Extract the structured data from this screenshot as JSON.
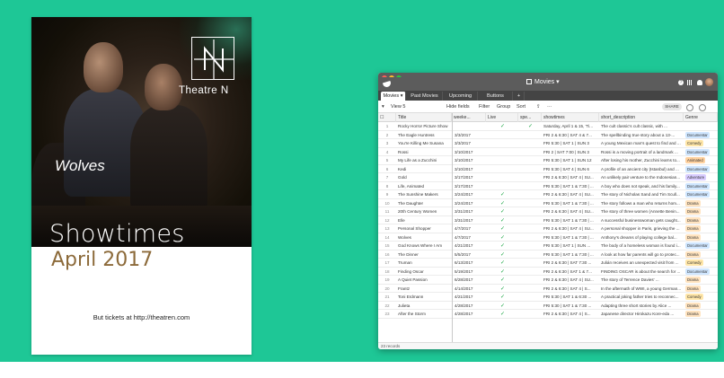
{
  "poster": {
    "brand": "Theatre N",
    "film_title": "Wolves",
    "heading": "Showtimes",
    "month": "April 2017",
    "tickets": "But tickets at http://theatren.com"
  },
  "app": {
    "base_title": "Movies ▾",
    "tabs": [
      "Movies ▾",
      "Past Movies",
      "Upcoming",
      "Buttons",
      "+"
    ],
    "view_name": "View 5",
    "toolbar": {
      "hide_fields": "Hide fields",
      "filter": "Filter",
      "group": "Group",
      "sort": "Sort",
      "share": "SHARE"
    },
    "columns": [
      "Title",
      "weeke...",
      "Live",
      "spe...",
      "showtimes",
      "short_description",
      "Genre"
    ],
    "rows": [
      {
        "n": "1",
        "title": "Rocky Horror Picture Show",
        "week": "",
        "live": true,
        "spe": true,
        "show": "Saturday, April 1 & 15, 'Ti...",
        "desc": "The cult classic's cult classic, with ...",
        "genre": ""
      },
      {
        "n": "2",
        "title": "The Eagle Huntress",
        "week": "3/3/2017",
        "live": false,
        "spe": false,
        "show": "FRI 2 & 6:30 | SAT 4 & 7...",
        "desc": "The spellbinding true story about a 13-...",
        "genre": "Documentar"
      },
      {
        "n": "3",
        "title": "You're Killing Me Susana",
        "week": "3/3/2017",
        "live": false,
        "spe": false,
        "show": "FRI 5:30 | SAT 1 | SUN 3",
        "desc": "A young Mexican man's quest to find and ...",
        "genre": "Comedy"
      },
      {
        "n": "4",
        "title": "Rossi",
        "week": "3/10/2017",
        "live": false,
        "spe": false,
        "show": "FRI 2 | SAT 7:00 | SUN 3",
        "desc": "Rossi is a moving portrait of a landmark ...",
        "genre": "Documentar"
      },
      {
        "n": "5",
        "title": "My Life as a Zucchini",
        "week": "3/10/2017",
        "live": false,
        "spe": false,
        "show": "FRI 5:30 | SAT 1 | SUN 12",
        "desc": "After losing his mother, Zucchini learns to...",
        "genre": "Animated"
      },
      {
        "n": "6",
        "title": "Kedi",
        "week": "3/10/2017",
        "live": false,
        "spe": false,
        "show": "FRI 5:30 | SAT 4 | SUN 6",
        "desc": "A profile of an ancient city (Istanbul) and ...",
        "genre": "Documentar"
      },
      {
        "n": "7",
        "title": "Gold",
        "week": "3/17/2017",
        "live": false,
        "spe": false,
        "show": "FRI 2 & 6:30 | SAT 4 | SU...",
        "desc": "An unlikely pair venture to the Indonesian...",
        "genre": "Adventure"
      },
      {
        "n": "8",
        "title": "Life, Animated",
        "week": "3/17/2017",
        "live": false,
        "spe": false,
        "show": "FRI 5:30 | SAT 1 & 7:30 | ...",
        "desc": "A boy who does not speak, and his family...",
        "genre": "Documentar"
      },
      {
        "n": "9",
        "title": "The Sunshine Makers",
        "week": "3/24/2017",
        "live": true,
        "spe": false,
        "show": "FRI 2 & 6:30 | SAT 4 | SU...",
        "desc": "The story of Nicholas Sand and Tim Scull...",
        "genre": "Documentar"
      },
      {
        "n": "10",
        "title": "The Daughter",
        "week": "3/24/2017",
        "live": true,
        "spe": false,
        "show": "FRI 5:30 | SAT 1 & 7:30 | ...",
        "desc": "The story follows a man who returns hom...",
        "genre": "Drama"
      },
      {
        "n": "11",
        "title": "20th Century Women",
        "week": "3/31/2017",
        "live": true,
        "spe": false,
        "show": "FRI 2 & 6:30 | SAT 4 | SU...",
        "desc": "The story of three women (Annette Benin...",
        "genre": "Drama"
      },
      {
        "n": "12",
        "title": "Elle",
        "week": "3/31/2017",
        "live": true,
        "spe": false,
        "show": "FRI 5:30 | SAT 1 & 7:30 | ...",
        "desc": "A successful businesswoman gets caught...",
        "genre": "Drama"
      },
      {
        "n": "13",
        "title": "Personal Shopper",
        "week": "4/7/2017",
        "live": true,
        "spe": false,
        "show": "FRI 2 & 6:30 | SAT 4 | SU...",
        "desc": "A personal shopper in Paris, grieving the ...",
        "genre": "Drama"
      },
      {
        "n": "14",
        "title": "Wolves",
        "week": "4/7/2017",
        "live": true,
        "spe": false,
        "show": "FRI 5:30 | SAT 1 & 7:30 | ...",
        "desc": "Anthony's dreams of playing college bal...",
        "genre": "Drama"
      },
      {
        "n": "15",
        "title": "God Knows Where I Am",
        "week": "4/21/2017",
        "live": true,
        "spe": false,
        "show": "FRI 5:30 | SAT 1 | SUN ...",
        "desc": "The body of a homeless woman is found i...",
        "genre": "Documentar"
      },
      {
        "n": "16",
        "title": "The Dinner",
        "week": "5/5/2017",
        "live": true,
        "spe": false,
        "show": "FRI 5:30 | SAT 1 & 7:30 | ...",
        "desc": "A look at how far parents will go to protec...",
        "genre": "Drama"
      },
      {
        "n": "17",
        "title": "Truman",
        "week": "6/13/2017",
        "live": true,
        "spe": false,
        "show": "FRI 2 & 6:30 | SAT 7:30 ...",
        "desc": "Julián receives an unexpected visit from ...",
        "genre": "Comedy"
      },
      {
        "n": "18",
        "title": "Finding Oscar",
        "week": "5/19/2017",
        "live": true,
        "spe": false,
        "show": "FRI 2 & 6:30 | SAT 1 & 7...",
        "desc": "FINDING OSCAR is about the search for ...",
        "genre": "Documentar"
      },
      {
        "n": "19",
        "title": "A Quiet Passion",
        "week": "6/28/2017",
        "live": true,
        "spe": false,
        "show": "FRI 2 & 6:30 | SAT 4 | SU...",
        "desc": "The story of Terrence Davies' ...",
        "genre": "Drama"
      },
      {
        "n": "20",
        "title": "Frantz",
        "week": "4/14/2017",
        "live": true,
        "spe": false,
        "show": "FRI 2 & 6:30 | SAT 4 | S...",
        "desc": "In the aftermath of WWI, a young German...",
        "genre": "Drama"
      },
      {
        "n": "21",
        "title": "Toni Erdmann",
        "week": "4/21/2017",
        "live": true,
        "spe": false,
        "show": "FRI 5:30 | SAT 1 & 6:30 ...",
        "desc": "A practical joking father tries to reconnec...",
        "genre": "Comedy"
      },
      {
        "n": "22",
        "title": "Julieta",
        "week": "4/28/2017",
        "live": true,
        "spe": false,
        "show": "FRI 5:30 | SAT 1 & 7:30 ...",
        "desc": "Adapting three short stories by Alice ...",
        "genre": "Drama"
      },
      {
        "n": "23",
        "title": "After the Storm",
        "week": "4/28/2017",
        "live": true,
        "spe": false,
        "show": "FRI 2 & 6:30 | SAT 4 | S...",
        "desc": "Japanese director Hirokazu Kore-eda ...",
        "genre": "Drama"
      }
    ],
    "footer": "23 records"
  },
  "colors": {
    "background": "#1ec796",
    "accent_brown": "#8c6a3a",
    "genre": {
      "Documentar": "#cfe6ff",
      "Comedy": "#ffe6a8",
      "Animated": "#ffd2a0",
      "Adventure": "#d8ccff",
      "Drama": "#ffe3bf"
    }
  }
}
